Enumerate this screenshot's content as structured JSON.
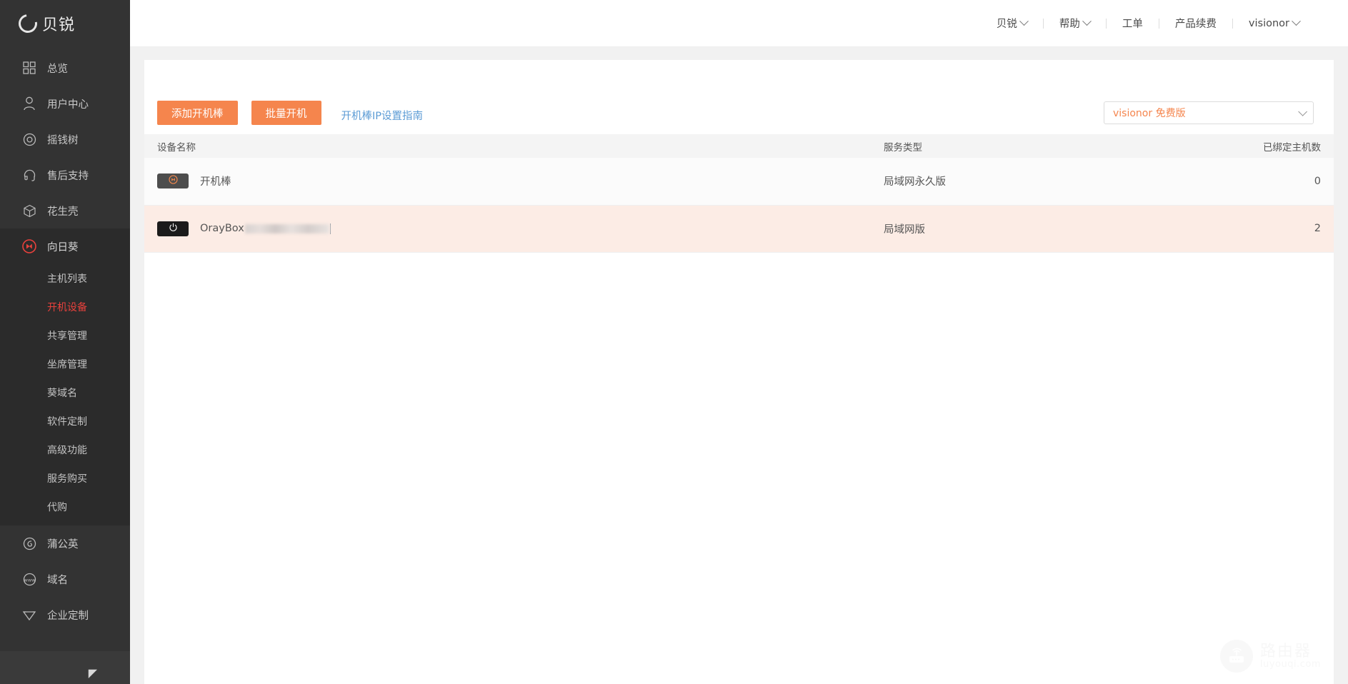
{
  "sidebar": {
    "logo": {
      "text": "贝锐",
      "icon": "ring-logo-icon"
    },
    "items": [
      {
        "label": "总览",
        "icon": "grid-icon"
      },
      {
        "label": "用户中心",
        "icon": "user-icon"
      },
      {
        "label": "摇钱树",
        "icon": "circle-target-icon"
      },
      {
        "label": "售后支持",
        "icon": "headset-icon"
      },
      {
        "label": "花生壳",
        "icon": "cube-icon"
      }
    ],
    "group": {
      "label": "向日葵",
      "icon": "sunflower-icon",
      "sub_items": [
        {
          "label": "主机列表",
          "active": false
        },
        {
          "label": "开机设备",
          "active": true
        },
        {
          "label": "共享管理",
          "active": false
        },
        {
          "label": "坐席管理",
          "active": false
        },
        {
          "label": "葵域名",
          "active": false
        },
        {
          "label": "软件定制",
          "active": false
        },
        {
          "label": "高级功能",
          "active": false
        },
        {
          "label": "服务购买",
          "active": false
        },
        {
          "label": "代购",
          "active": false
        }
      ]
    },
    "items_after": [
      {
        "label": "蒲公英",
        "icon": "dandelion-icon"
      },
      {
        "label": "域名",
        "icon": "www-icon"
      },
      {
        "label": "企业定制",
        "icon": "diamond-icon"
      }
    ],
    "collapse_label": "◤"
  },
  "topbar": {
    "items": [
      {
        "label": "贝锐",
        "has_caret": true
      },
      {
        "label": "帮助",
        "has_caret": true
      },
      {
        "label": "工单",
        "has_caret": false
      },
      {
        "label": "产品续费",
        "has_caret": false
      },
      {
        "label": "visionor",
        "has_caret": true
      }
    ]
  },
  "toolbar": {
    "add_button": "添加开机棒",
    "batch_button": "批量开机",
    "guide_link": "开机棒IP设置指南",
    "version_select": "visionor 免费版"
  },
  "table": {
    "columns": [
      "设备名称",
      "服务类型",
      "已绑定主机数"
    ],
    "rows": [
      {
        "name": "开机棒",
        "badge_icon": "sunflower-icon",
        "badge_style": "gray",
        "redacted": false,
        "service_type": "局域网永久版",
        "bound_count": "0",
        "highlight": false
      },
      {
        "name": "OrayBox",
        "badge_icon": "power-icon",
        "badge_style": "black",
        "redacted": true,
        "service_type": "局域网版",
        "bound_count": "2",
        "highlight": true
      }
    ]
  },
  "watermark": {
    "cn": "路由器",
    "en": "luyouqi.com",
    "icon": "router-icon"
  },
  "colors": {
    "accent_orange": "#f5854d",
    "active_red": "#e8413c",
    "link_blue": "#5b9bd5",
    "sidebar_bg": "#333333",
    "sidebar_group_bg": "#2b2b2b",
    "row_highlight": "#fcece5"
  }
}
